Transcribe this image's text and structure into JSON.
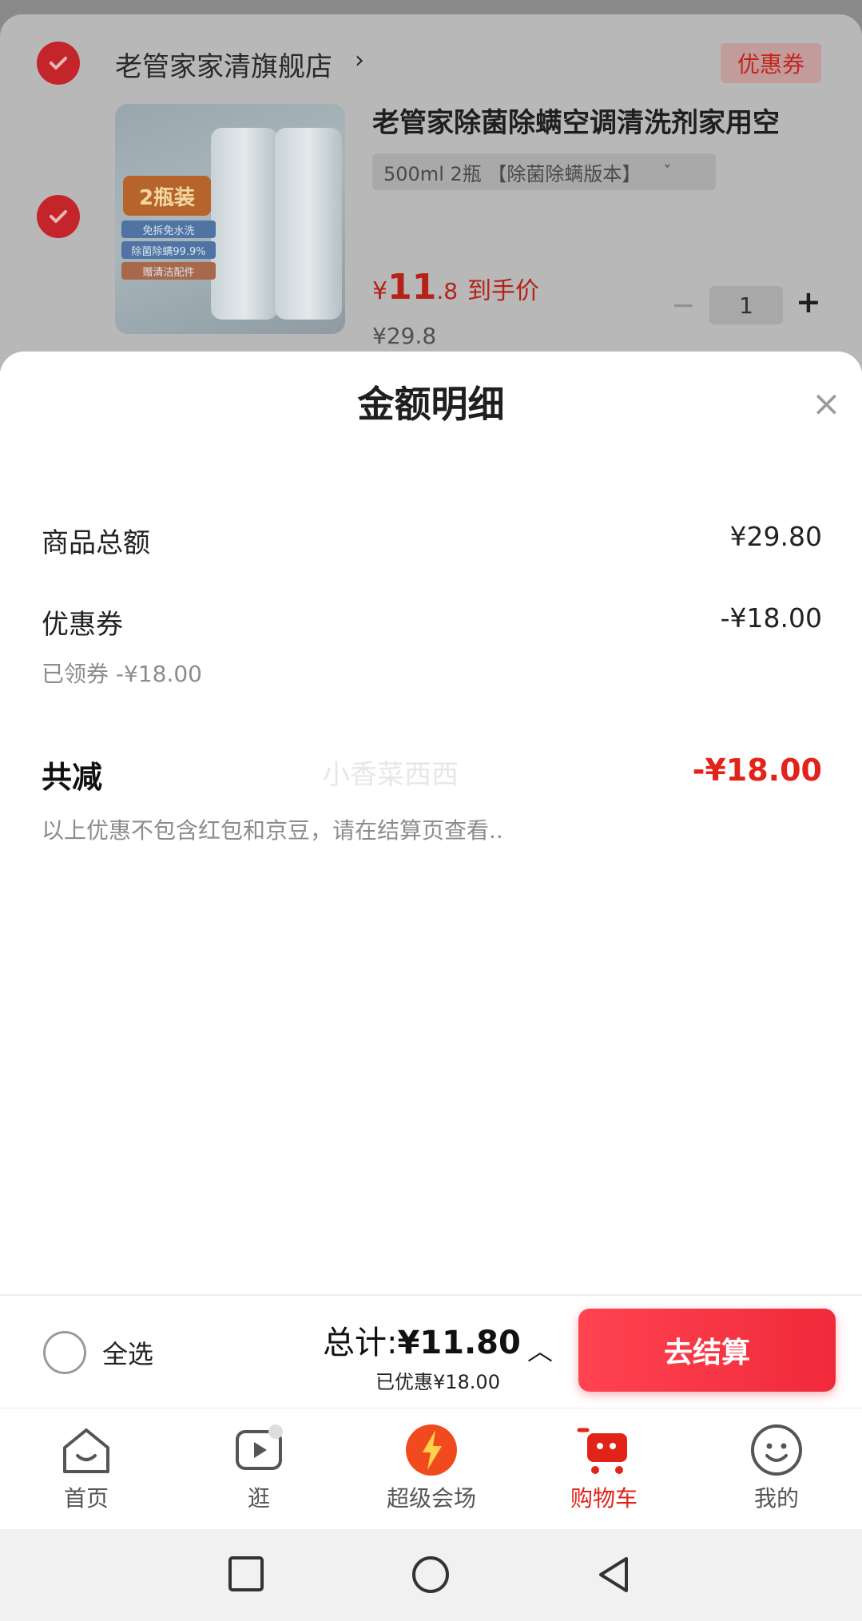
{
  "store": {
    "name": "老管家家清旗舰店",
    "arrow": "›",
    "coupon_tag": "优惠券"
  },
  "product": {
    "title": "老管家除菌除螨空调清洗剂家用空",
    "sku": "500ml 2瓶 【除菌除螨版本】",
    "sku_chevron": "ˇ",
    "image_badge": "2瓶装",
    "image_strip_1": "免拆免水洗",
    "image_strip_2": "除菌除螨99.9%",
    "image_strip_3": "赠清洁配件",
    "price_currency": "¥",
    "price_int": "11",
    "price_dec": ".8",
    "price_tail": "到手价",
    "price_original": "¥29.8",
    "quantity": "1",
    "qty_minus": "−",
    "qty_plus": "+"
  },
  "sheet": {
    "title": "金额明细",
    "close": "×",
    "rows": {
      "goods_total_label": "商品总额",
      "goods_total_value": "¥29.80",
      "coupon_label": "优惠券",
      "coupon_value": "-¥18.00",
      "coupon_sub": "已领券 -¥18.00"
    },
    "total_reduce_label": "共减",
    "total_reduce_value": "-¥18.00",
    "watermark": "小香菜西西",
    "note": "以上优惠不包含红包和京豆，请在结算页查看.."
  },
  "checkout": {
    "select_all": "全选",
    "total_label": "总计:",
    "total_value": "¥11.80",
    "saved": "已优惠¥18.00",
    "caret": "︿",
    "button": "去结算"
  },
  "tabs": [
    {
      "label": "首页",
      "icon": "home-icon"
    },
    {
      "label": "逛",
      "icon": "video-icon"
    },
    {
      "label": "超级会场",
      "icon": "super-venue-icon"
    },
    {
      "label": "购物车",
      "icon": "cart-icon",
      "active": true
    },
    {
      "label": "我的",
      "icon": "profile-icon"
    }
  ],
  "colors": {
    "accent": "#e2231a",
    "checkout_button": "#f02a3a"
  }
}
